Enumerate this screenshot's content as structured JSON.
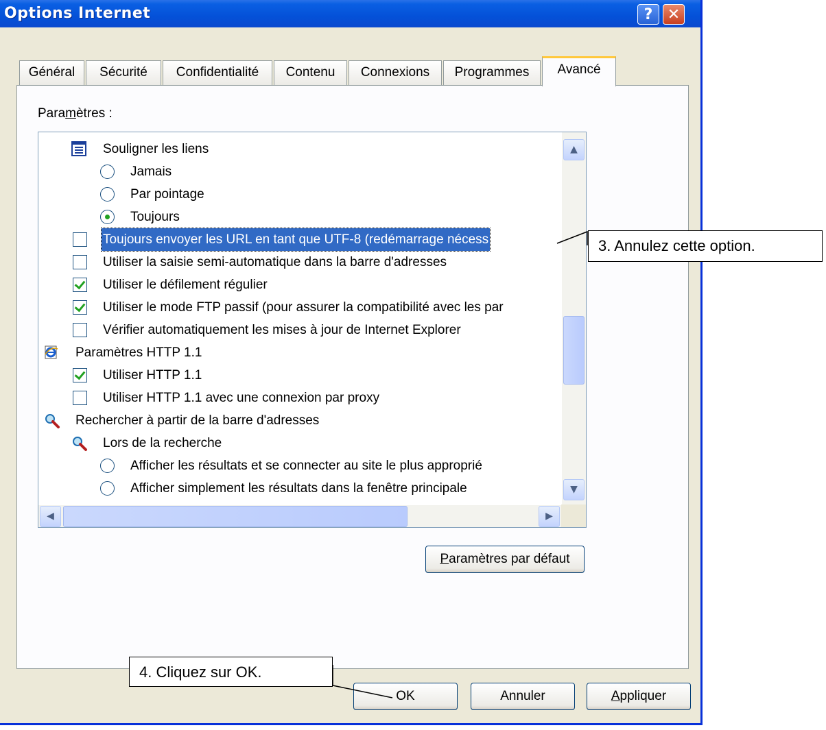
{
  "window": {
    "title": "Options Internet",
    "help_glyph": "?",
    "close_glyph": "✕"
  },
  "tabs": [
    {
      "label": "Général"
    },
    {
      "label": "Sécurité"
    },
    {
      "label": "Confidentialité"
    },
    {
      "label": "Contenu"
    },
    {
      "label": "Connexions"
    },
    {
      "label": "Programmes"
    },
    {
      "label": "Avancé",
      "active": true
    }
  ],
  "settings": {
    "label_prefix": "Para",
    "label_mnemonic": "m",
    "label_suffix": "ètres :",
    "items": [
      {
        "kind": "group",
        "icon": "list-icon",
        "label": "Souligner les liens"
      },
      {
        "kind": "radio",
        "checked": false,
        "label": "Jamais"
      },
      {
        "kind": "radio",
        "checked": false,
        "label": "Par pointage"
      },
      {
        "kind": "radio",
        "checked": true,
        "label": "Toujours"
      },
      {
        "kind": "checkbox",
        "checked": false,
        "selected": true,
        "label": "Toujours envoyer les URL en tant que UTF-8 (redémarrage nécess"
      },
      {
        "kind": "checkbox",
        "checked": false,
        "label": "Utiliser la saisie semi-automatique dans la barre d'adresses"
      },
      {
        "kind": "checkbox",
        "checked": true,
        "label": "Utiliser le défilement régulier"
      },
      {
        "kind": "checkbox",
        "checked": true,
        "label": "Utiliser le mode FTP passif (pour assurer la compatibilité avec les par"
      },
      {
        "kind": "checkbox",
        "checked": false,
        "label": "Vérifier automatiquement les mises à jour de Internet Explorer"
      },
      {
        "kind": "group",
        "icon": "ie-icon",
        "label": "Paramètres HTTP 1.1"
      },
      {
        "kind": "checkbox",
        "checked": true,
        "label": "Utiliser HTTP 1.1"
      },
      {
        "kind": "checkbox",
        "checked": false,
        "label": "Utiliser HTTP 1.1 avec une connexion par proxy"
      },
      {
        "kind": "group",
        "icon": "search-magnifier-icon",
        "label": "Rechercher à partir de la barre d'adresses"
      },
      {
        "kind": "subgroup",
        "icon": "search-magnifier-icon",
        "label": "Lors de la recherche"
      },
      {
        "kind": "radio2",
        "checked": false,
        "label": "Afficher les résultats et se connecter au site le plus approprié"
      },
      {
        "kind": "radio2",
        "checked": false,
        "label": "Afficher simplement les résultats dans la fenêtre principale"
      }
    ],
    "vertical_scroll_position": 0.55,
    "horizontal_scroll_position": 0.0
  },
  "buttons": {
    "defaults_mnemonic": "P",
    "defaults_rest": "aramètres par défaut",
    "ok": "OK",
    "cancel": "Annuler",
    "apply_mnemonic": "A",
    "apply_rest": "ppliquer"
  },
  "callouts": {
    "step3": "3. Annulez cette option.",
    "step4": "4. Cliquez sur OK."
  }
}
